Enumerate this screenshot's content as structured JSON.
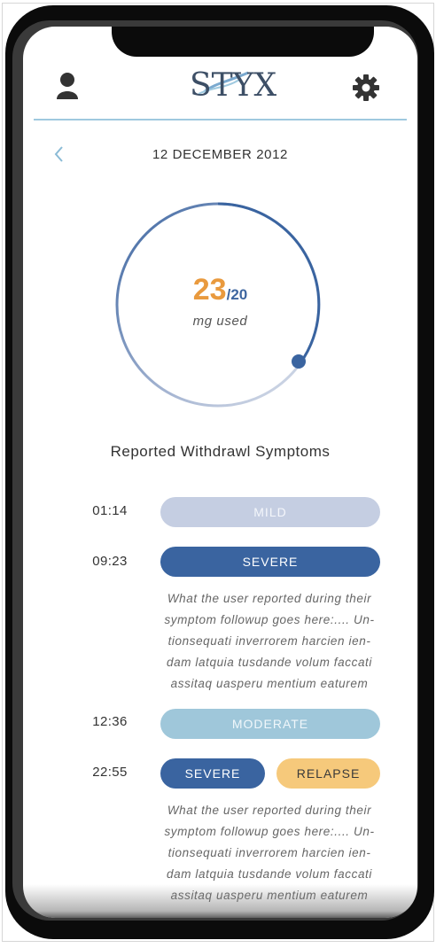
{
  "header": {
    "profile_icon": "user-icon",
    "settings_icon": "gear-icon",
    "logo_text": "STYX"
  },
  "date_nav": {
    "back_icon": "chevron-left-icon",
    "date": "12 DECEMBER 2012"
  },
  "dosage": {
    "used": "23",
    "limit": "/20",
    "unit": "mg used",
    "colors": {
      "used": "#e99a3e",
      "limit": "#3e66a0",
      "ring": "#3a64a0"
    }
  },
  "symptoms": {
    "title": "Reported Withdrawl Symptoms",
    "entries": [
      {
        "time": "01:14",
        "tags": [
          "MILD"
        ]
      },
      {
        "time": "09:23",
        "tags": [
          "SEVERE"
        ],
        "note_lines": [
          "What the user reported during their",
          "symptom followup goes here:.... Un-",
          "tionsequati inverrorem harcien ien-",
          "dam latquia tusdande volum faccati",
          "assitaq uasperu mentium eaturem"
        ]
      },
      {
        "time": "12:36",
        "tags": [
          "MODERATE"
        ]
      },
      {
        "time": "22:55",
        "tags": [
          "SEVERE",
          "RELAPSE"
        ],
        "note_lines": [
          "What the user reported during their",
          "symptom followup goes here:.... Un-",
          "tionsequati inverrorem harcien ien-",
          "dam latquia tusdande volum faccati",
          "assitaq uasperu mentium eaturem"
        ]
      }
    ],
    "colors": {
      "mild": "#c5cee2",
      "severe": "#3a64a0",
      "moderate": "#9fc7da",
      "relapse": "#f6c97b"
    }
  }
}
